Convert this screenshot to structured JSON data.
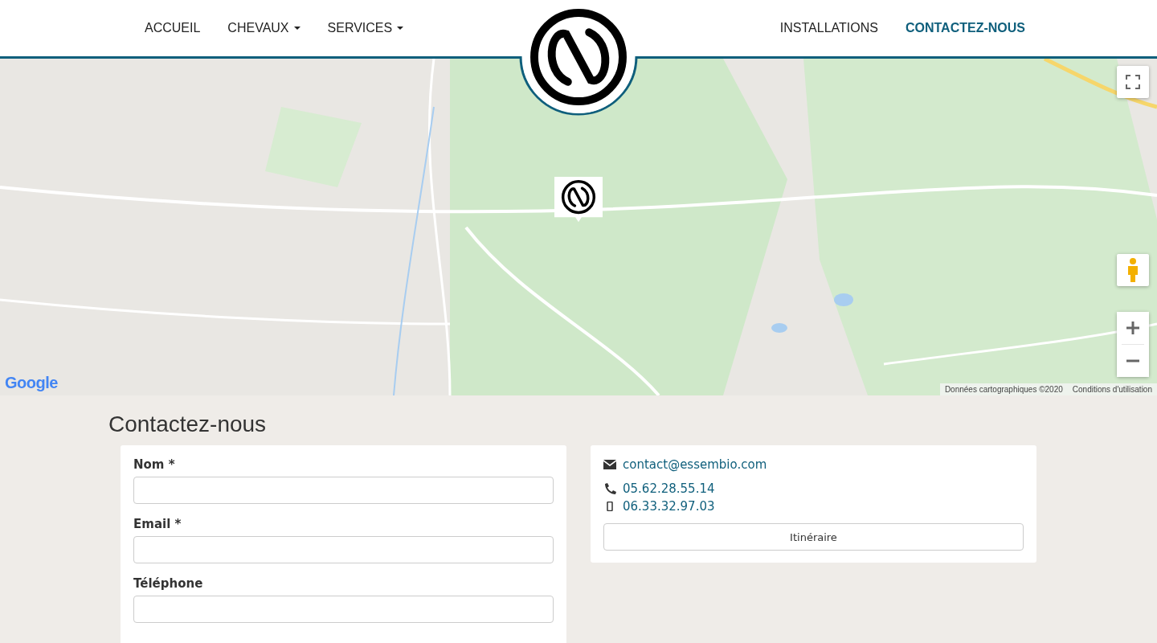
{
  "header": {
    "nav_left": [
      {
        "label": "ACCUEIL",
        "dropdown": false,
        "selected": false
      },
      {
        "label": "CHEVAUX",
        "dropdown": true,
        "selected": false
      },
      {
        "label": "SERVICES",
        "dropdown": true,
        "selected": false
      }
    ],
    "nav_right": [
      {
        "label": "INSTALLATIONS",
        "dropdown": false,
        "selected": false
      },
      {
        "label": "CONTACTEZ-NOUS",
        "dropdown": false,
        "selected": true
      }
    ]
  },
  "map": {
    "kind": "picture",
    "google_logo": "Google",
    "attribution": "Données cartographiques ©2020",
    "terms": "Conditions d'utilisation"
  },
  "contact": {
    "heading": "Contactez-nous",
    "form_fields": [
      {
        "label": "Nom *"
      },
      {
        "label": "Email *"
      },
      {
        "label": "Téléphone"
      }
    ],
    "email": "contact@essembio.com",
    "phones": [
      {
        "kind": "phone",
        "number": "05.62.28.55.14"
      },
      {
        "kind": "mobile",
        "number": "06.33.32.97.03"
      }
    ],
    "directions_button": "Itinéraire"
  }
}
